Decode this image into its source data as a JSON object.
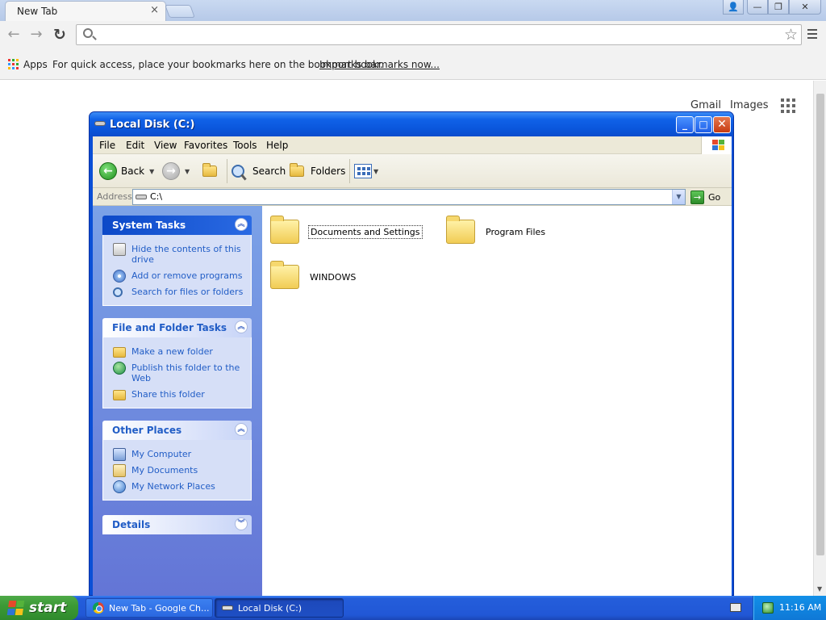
{
  "chrome": {
    "tab_title": "New Tab",
    "tab_close": "×",
    "window_buttons": {
      "user": "👤",
      "minimize": "—",
      "maximize": "❐",
      "close": "✕"
    },
    "nav": {
      "back": "←",
      "forward": "→",
      "reload": "↻"
    },
    "omnibox": {
      "value": "",
      "star": "☆"
    },
    "bookmarks": {
      "apps_label": "Apps",
      "message": "For quick access, place your bookmarks here on the bookmarks bar.",
      "import_link": "Import bookmarks now..."
    },
    "page": {
      "gmail": "Gmail",
      "images": "Images"
    }
  },
  "explorer": {
    "title": "Local Disk (C:)",
    "caption_buttons": {
      "minimize": "_",
      "maximize": "□",
      "close": "✕"
    },
    "menu": [
      "File",
      "Edit",
      "View",
      "Favorites",
      "Tools",
      "Help"
    ],
    "toolbar": {
      "back": "Back",
      "search": "Search",
      "folders": "Folders"
    },
    "address": {
      "label": "Address",
      "value": "C:\\",
      "go": "Go"
    },
    "panels": {
      "system_tasks": {
        "title": "System Tasks",
        "items": [
          "Hide the contents of this drive",
          "Add or remove programs",
          "Search for files or folders"
        ]
      },
      "file_folder_tasks": {
        "title": "File and Folder Tasks",
        "items": [
          "Make a new folder",
          "Publish this folder to the Web",
          "Share this folder"
        ]
      },
      "other_places": {
        "title": "Other Places",
        "items": [
          "My Computer",
          "My Documents",
          "My Network Places"
        ]
      },
      "details": {
        "title": "Details"
      }
    },
    "files": [
      "Documents and Settings",
      "Program Files",
      "WINDOWS"
    ]
  },
  "taskbar": {
    "start": "start",
    "tasks": [
      "New Tab - Google Ch...",
      "Local Disk (C:)"
    ],
    "clock": "11:16 AM"
  },
  "colors": {
    "xp_blue": "#0a4fd6",
    "start_green": "#3c9a36",
    "task_pane": "#6375d6",
    "link_blue": "#215dc6"
  }
}
